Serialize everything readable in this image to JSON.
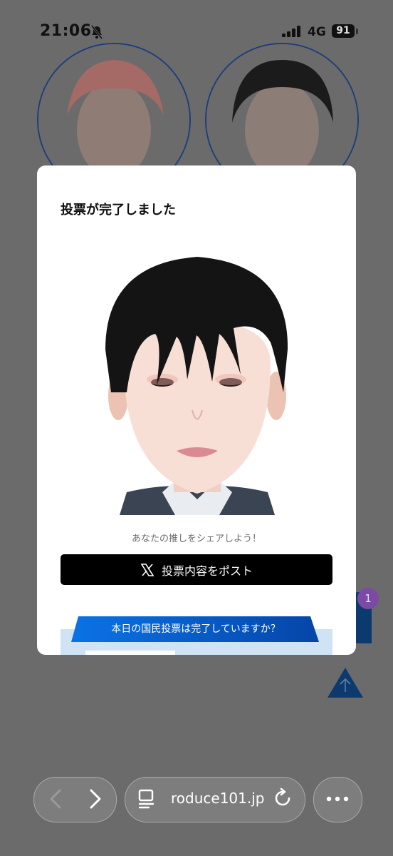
{
  "status_bar": {
    "time": "21:06",
    "network": "4G",
    "battery": "91"
  },
  "modal": {
    "title": "投票が完了しました",
    "share_prompt": "あなたの推しをシェアしよう！",
    "post_button_label": "投票内容をポスト",
    "banner_text": "本日の国民投票は完了していますか？"
  },
  "background": {
    "notification_count": "1"
  },
  "browser": {
    "url": "roduce101.jp"
  },
  "colors": {
    "accent_blue": "#0d5bd0",
    "post_button": "#000000",
    "banner_bg": "#cfe3f5"
  }
}
